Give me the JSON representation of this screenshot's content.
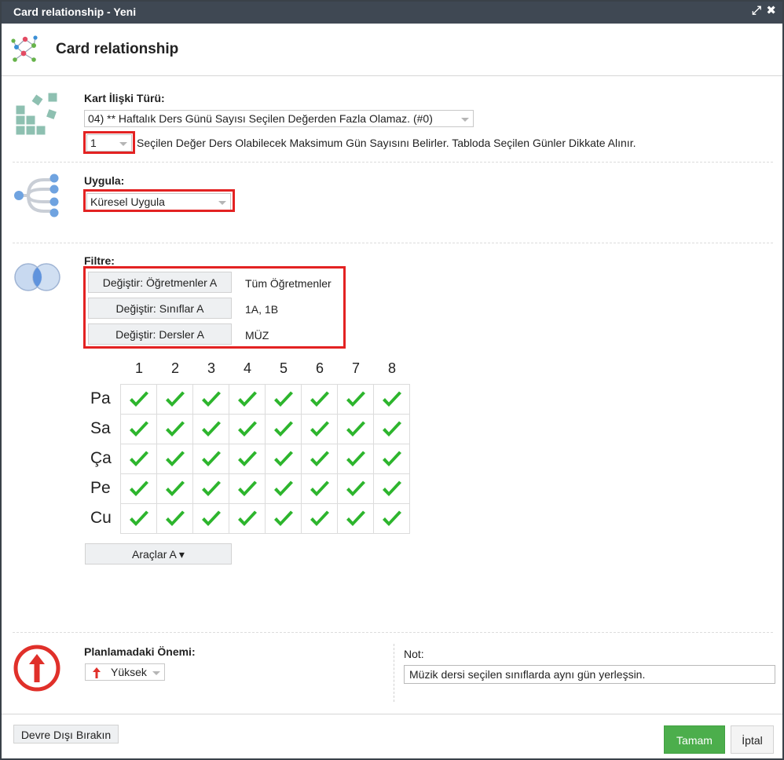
{
  "window": {
    "title": "Card relationship - Yeni",
    "maximize_icon": "⤢",
    "close_icon": "✖"
  },
  "header": {
    "title": "Card relationship"
  },
  "relation_type": {
    "label": "Kart İlişki Türü:",
    "selected": "04) ** Haftalık Ders Günü Sayısı Seçilen Değerden Fazla Olamaz. (#0)",
    "count_value": "1",
    "description": "Seçilen Değer Ders Olabilecek Maksimum Gün Sayısını Belirler. Tabloda Seçilen Günler Dikkate Alınır."
  },
  "apply": {
    "label": "Uygula:",
    "selected": "Küresel Uygula"
  },
  "filter": {
    "label": "Filtre:",
    "rows": [
      {
        "button": "Değiştir: Öğretmenler A",
        "value": "Tüm Öğretmenler"
      },
      {
        "button": "Değiştir: Sınıflar A",
        "value": "1A, 1B"
      },
      {
        "button": "Değiştir: Dersler A",
        "value": "MÜZ"
      }
    ]
  },
  "grid": {
    "columns": [
      "1",
      "2",
      "3",
      "4",
      "5",
      "6",
      "7",
      "8"
    ],
    "rows": [
      "Pa",
      "Sa",
      "Ça",
      "Pe",
      "Cu"
    ],
    "checked": [
      [
        true,
        true,
        true,
        true,
        true,
        true,
        true,
        true
      ],
      [
        true,
        true,
        true,
        true,
        true,
        true,
        true,
        true
      ],
      [
        true,
        true,
        true,
        true,
        true,
        true,
        true,
        true
      ],
      [
        true,
        true,
        true,
        true,
        true,
        true,
        true,
        true
      ],
      [
        true,
        true,
        true,
        true,
        true,
        true,
        true,
        true
      ]
    ],
    "check_color": "#2db52d"
  },
  "tools_button": "Araçlar A ▾",
  "importance": {
    "label": "Planlamadaki Önemi:",
    "selected": "Yüksek",
    "icon_color": "#e0302a"
  },
  "note": {
    "label": "Not:",
    "value": "Müzik dersi seçilen sınıflarda aynı gün yerleşsin."
  },
  "footer": {
    "disable_label": "Devre Dışı Bırakın",
    "ok_label": "Tamam",
    "cancel_label": "İptal",
    "ok_color": "#4cae4c"
  }
}
